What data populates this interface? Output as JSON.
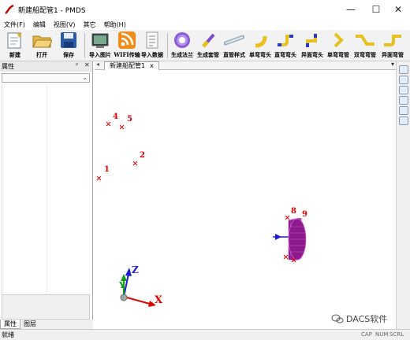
{
  "window": {
    "title": "新建船配管1 - PMDS",
    "min": "—",
    "max": "☐",
    "close": "✕"
  },
  "menu": [
    "文件(F)",
    "编辑",
    "视图(V)",
    "其它",
    "帮助(H)"
  ],
  "toolbar": [
    {
      "label": "新建",
      "icon": "new-file-icon"
    },
    {
      "label": "打开",
      "icon": "open-folder-icon"
    },
    {
      "label": "保存",
      "icon": "save-disk-icon"
    },
    {
      "label": "导入图片",
      "icon": "import-image-icon"
    },
    {
      "label": "WIFI传输",
      "icon": "wifi-rss-icon"
    },
    {
      "label": "导入数据",
      "icon": "import-data-icon"
    },
    {
      "label": "生成法兰",
      "icon": "flange-icon"
    },
    {
      "label": "生成套管",
      "icon": "sleeve-icon"
    },
    {
      "label": "直管样式",
      "icon": "straight-pipe-icon"
    },
    {
      "label": "单弯弯头",
      "icon": "single-elbow-icon"
    },
    {
      "label": "直弯弯头",
      "icon": "straight-elbow-icon"
    },
    {
      "label": "异面弯头",
      "icon": "skew-elbow-icon"
    },
    {
      "label": "单弯弯管",
      "icon": "single-bend-pipe-icon"
    },
    {
      "label": "双弯弯管",
      "icon": "double-bend-pipe-icon"
    },
    {
      "label": "异面弯管",
      "icon": "skew-bend-pipe-icon"
    }
  ],
  "left_panel": {
    "title": "属性",
    "pin": "ᵖ",
    "close": "✕",
    "tabs": [
      "属性",
      "图层"
    ]
  },
  "document": {
    "tab": "新建船配管1",
    "tab_close": "x"
  },
  "viewport": {
    "points": [
      "1",
      "2",
      "4",
      "5",
      "8",
      "9"
    ],
    "axes": {
      "x": "X",
      "y": "Y",
      "z": "Z"
    },
    "colors": {
      "point": "#e00000",
      "sleeve": "#8b1a8b",
      "x_axis": "#e00000",
      "y_axis": "#12a012",
      "z_axis": "#1a1ad8"
    }
  },
  "status": {
    "text": "就绪",
    "caps": "CAP",
    "num": "NUM",
    "scrl": "SCRL"
  },
  "watermark": {
    "text": "DACS软件"
  }
}
